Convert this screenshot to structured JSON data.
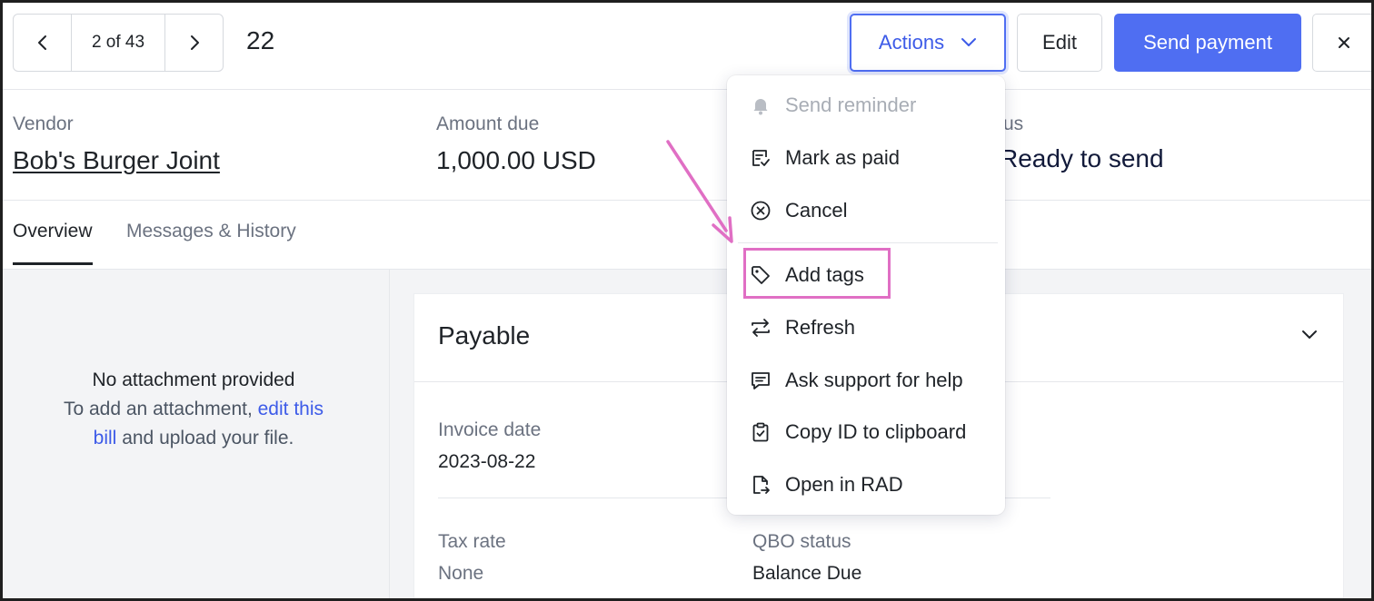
{
  "pager": {
    "count": "2 of 43",
    "bill_number": "22"
  },
  "header_buttons": {
    "actions_label": "Actions",
    "edit_label": "Edit",
    "send_payment_label": "Send payment"
  },
  "summary": {
    "vendor_label": "Vendor",
    "vendor_name": "Bob's Burger Joint",
    "amount_label": "Amount due",
    "amount_value": "1,000.00 USD",
    "status_label_partial": "us",
    "status_value_partial": "Ready to send"
  },
  "tabs": [
    {
      "label": "Overview",
      "active": true
    },
    {
      "label": "Messages & History",
      "active": false
    }
  ],
  "attachment": {
    "title": "No attachment provided",
    "line1_prefix": "To add an attachment, ",
    "link_text_1": "edit this",
    "link_text_2": "bill",
    "line_suffix": " and upload your file."
  },
  "card": {
    "title": "Payable",
    "invoice_date_label": "Invoice date",
    "invoice_date_value": "2023-08-22",
    "tax_rate_label": "Tax rate",
    "tax_rate_value": "None",
    "qbo_status_label": "QBO status",
    "qbo_status_value": "Balance Due"
  },
  "menu": {
    "items": [
      {
        "label": "Send reminder",
        "icon": "bell-icon",
        "disabled": true
      },
      {
        "label": "Mark as paid",
        "icon": "receipt-check-icon",
        "disabled": false
      },
      {
        "label": "Cancel",
        "icon": "x-circle-icon",
        "disabled": false
      },
      {
        "label": "Add tags",
        "icon": "tag-icon",
        "disabled": false,
        "highlighted": true
      },
      {
        "label": "Refresh",
        "icon": "refresh-arrows-icon",
        "disabled": false
      },
      {
        "label": "Ask support for help",
        "icon": "chat-icon",
        "disabled": false
      },
      {
        "label": "Copy ID to clipboard",
        "icon": "clipboard-check-icon",
        "disabled": false
      },
      {
        "label": "Open in RAD",
        "icon": "file-arrow-icon",
        "disabled": false
      }
    ]
  },
  "colors": {
    "primary": "#4f6ef2",
    "link": "#3d5be8",
    "annotation": "#e06fc4",
    "muted_text": "#6b7280"
  }
}
